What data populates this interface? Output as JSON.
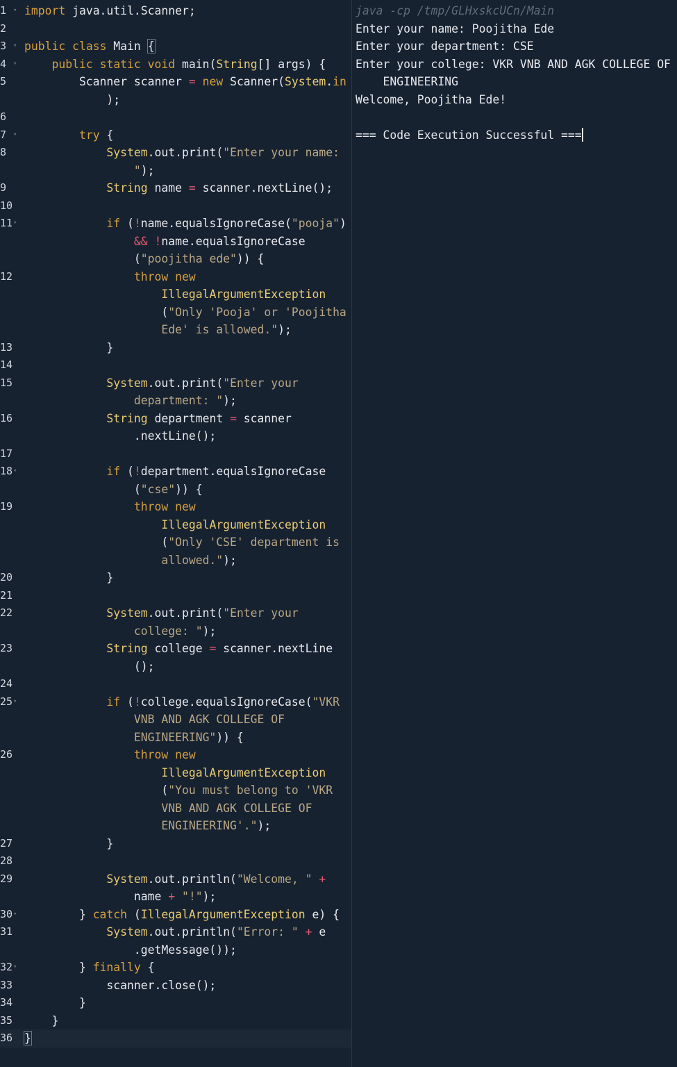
{
  "editor": {
    "lines": [
      {
        "num": "1",
        "fold": true,
        "tokens": [
          [
            "kw",
            "import"
          ],
          [
            "pl",
            " java.util.Scanner;"
          ]
        ]
      },
      {
        "num": "2",
        "fold": false,
        "tokens": []
      },
      {
        "num": "3",
        "fold": true,
        "tokens": [
          [
            "kw",
            "public"
          ],
          [
            "pl",
            " "
          ],
          [
            "kw",
            "class"
          ],
          [
            "pl",
            " Main "
          ],
          [
            "bracket",
            "{"
          ]
        ]
      },
      {
        "num": "4",
        "fold": true,
        "tokens": [
          [
            "pl",
            "    "
          ],
          [
            "kw",
            "public"
          ],
          [
            "pl",
            " "
          ],
          [
            "kw",
            "static"
          ],
          [
            "pl",
            " "
          ],
          [
            "kw",
            "void"
          ],
          [
            "pl",
            " main("
          ],
          [
            "cls",
            "String"
          ],
          [
            "pl",
            "[] args) {"
          ]
        ]
      },
      {
        "num": "5",
        "fold": false,
        "tokens": [
          [
            "pl",
            "        Scanner scanner "
          ],
          [
            "op",
            "="
          ],
          [
            "pl",
            " "
          ],
          [
            "kw",
            "new"
          ],
          [
            "pl",
            " Scanner("
          ],
          [
            "cls",
            "System"
          ],
          [
            "pl",
            "."
          ],
          [
            "kw",
            "in"
          ]
        ]
      },
      {
        "num": "",
        "fold": false,
        "tokens": [
          [
            "pl",
            "            );"
          ]
        ]
      },
      {
        "num": "6",
        "fold": false,
        "tokens": []
      },
      {
        "num": "7",
        "fold": true,
        "tokens": [
          [
            "pl",
            "        "
          ],
          [
            "kw",
            "try"
          ],
          [
            "pl",
            " {"
          ]
        ]
      },
      {
        "num": "8",
        "fold": false,
        "tokens": [
          [
            "pl",
            "            "
          ],
          [
            "cls",
            "System"
          ],
          [
            "pl",
            ".out.print("
          ],
          [
            "str",
            "\"Enter your name:"
          ]
        ]
      },
      {
        "num": "",
        "fold": false,
        "tokens": [
          [
            "str",
            "                \""
          ],
          [
            "pl",
            ");"
          ]
        ]
      },
      {
        "num": "9",
        "fold": false,
        "tokens": [
          [
            "pl",
            "            "
          ],
          [
            "cls",
            "String"
          ],
          [
            "pl",
            " name "
          ],
          [
            "op",
            "="
          ],
          [
            "pl",
            " scanner.nextLine();"
          ]
        ]
      },
      {
        "num": "10",
        "fold": false,
        "tokens": []
      },
      {
        "num": "11",
        "fold": true,
        "tokens": [
          [
            "pl",
            "            "
          ],
          [
            "kw",
            "if"
          ],
          [
            "pl",
            " ("
          ],
          [
            "op",
            "!"
          ],
          [
            "pl",
            "name.equalsIgnoreCase("
          ],
          [
            "str",
            "\"pooja\""
          ],
          [
            "pl",
            ")"
          ]
        ]
      },
      {
        "num": "",
        "fold": false,
        "tokens": [
          [
            "pl",
            "                "
          ],
          [
            "op",
            "&&"
          ],
          [
            "pl",
            " "
          ],
          [
            "op",
            "!"
          ],
          [
            "pl",
            "name.equalsIgnoreCase"
          ]
        ]
      },
      {
        "num": "",
        "fold": false,
        "tokens": [
          [
            "pl",
            "                ("
          ],
          [
            "str",
            "\"poojitha ede\""
          ],
          [
            "pl",
            ")) {"
          ]
        ]
      },
      {
        "num": "12",
        "fold": false,
        "tokens": [
          [
            "pl",
            "                "
          ],
          [
            "kw",
            "throw"
          ],
          [
            "pl",
            " "
          ],
          [
            "kw",
            "new"
          ]
        ]
      },
      {
        "num": "",
        "fold": false,
        "tokens": [
          [
            "pl",
            "                    "
          ],
          [
            "ex",
            "IllegalArgumentException"
          ]
        ]
      },
      {
        "num": "",
        "fold": false,
        "tokens": [
          [
            "pl",
            "                    ("
          ],
          [
            "str",
            "\"Only 'Pooja' or 'Poojitha"
          ]
        ]
      },
      {
        "num": "",
        "fold": false,
        "tokens": [
          [
            "str",
            "                    Ede' is allowed.\""
          ],
          [
            "pl",
            ");"
          ]
        ]
      },
      {
        "num": "13",
        "fold": false,
        "tokens": [
          [
            "pl",
            "            }"
          ]
        ]
      },
      {
        "num": "14",
        "fold": false,
        "tokens": []
      },
      {
        "num": "15",
        "fold": false,
        "tokens": [
          [
            "pl",
            "            "
          ],
          [
            "cls",
            "System"
          ],
          [
            "pl",
            ".out.print("
          ],
          [
            "str",
            "\"Enter your"
          ]
        ]
      },
      {
        "num": "",
        "fold": false,
        "tokens": [
          [
            "str",
            "                department: \""
          ],
          [
            "pl",
            ");"
          ]
        ]
      },
      {
        "num": "16",
        "fold": false,
        "tokens": [
          [
            "pl",
            "            "
          ],
          [
            "cls",
            "String"
          ],
          [
            "pl",
            " department "
          ],
          [
            "op",
            "="
          ],
          [
            "pl",
            " scanner"
          ]
        ]
      },
      {
        "num": "",
        "fold": false,
        "tokens": [
          [
            "pl",
            "                .nextLine();"
          ]
        ]
      },
      {
        "num": "17",
        "fold": false,
        "tokens": []
      },
      {
        "num": "18",
        "fold": true,
        "tokens": [
          [
            "pl",
            "            "
          ],
          [
            "kw",
            "if"
          ],
          [
            "pl",
            " ("
          ],
          [
            "op",
            "!"
          ],
          [
            "pl",
            "department.equalsIgnoreCase"
          ]
        ]
      },
      {
        "num": "",
        "fold": false,
        "tokens": [
          [
            "pl",
            "                ("
          ],
          [
            "str",
            "\"cse\""
          ],
          [
            "pl",
            ")) {"
          ]
        ]
      },
      {
        "num": "19",
        "fold": false,
        "tokens": [
          [
            "pl",
            "                "
          ],
          [
            "kw",
            "throw"
          ],
          [
            "pl",
            " "
          ],
          [
            "kw",
            "new"
          ]
        ]
      },
      {
        "num": "",
        "fold": false,
        "tokens": [
          [
            "pl",
            "                    "
          ],
          [
            "ex",
            "IllegalArgumentException"
          ]
        ]
      },
      {
        "num": "",
        "fold": false,
        "tokens": [
          [
            "pl",
            "                    ("
          ],
          [
            "str",
            "\"Only 'CSE' department is"
          ]
        ]
      },
      {
        "num": "",
        "fold": false,
        "tokens": [
          [
            "str",
            "                    allowed.\""
          ],
          [
            "pl",
            ");"
          ]
        ]
      },
      {
        "num": "20",
        "fold": false,
        "tokens": [
          [
            "pl",
            "            }"
          ]
        ]
      },
      {
        "num": "21",
        "fold": false,
        "tokens": []
      },
      {
        "num": "22",
        "fold": false,
        "tokens": [
          [
            "pl",
            "            "
          ],
          [
            "cls",
            "System"
          ],
          [
            "pl",
            ".out.print("
          ],
          [
            "str",
            "\"Enter your"
          ]
        ]
      },
      {
        "num": "",
        "fold": false,
        "tokens": [
          [
            "str",
            "                college: \""
          ],
          [
            "pl",
            ");"
          ]
        ]
      },
      {
        "num": "23",
        "fold": false,
        "tokens": [
          [
            "pl",
            "            "
          ],
          [
            "cls",
            "String"
          ],
          [
            "pl",
            " college "
          ],
          [
            "op",
            "="
          ],
          [
            "pl",
            " scanner.nextLine"
          ]
        ]
      },
      {
        "num": "",
        "fold": false,
        "tokens": [
          [
            "pl",
            "                ();"
          ]
        ]
      },
      {
        "num": "24",
        "fold": false,
        "tokens": []
      },
      {
        "num": "25",
        "fold": true,
        "tokens": [
          [
            "pl",
            "            "
          ],
          [
            "kw",
            "if"
          ],
          [
            "pl",
            " ("
          ],
          [
            "op",
            "!"
          ],
          [
            "pl",
            "college.equalsIgnoreCase("
          ],
          [
            "str",
            "\"VKR"
          ]
        ]
      },
      {
        "num": "",
        "fold": false,
        "tokens": [
          [
            "str",
            "                VNB AND AGK COLLEGE OF"
          ]
        ]
      },
      {
        "num": "",
        "fold": false,
        "tokens": [
          [
            "str",
            "                ENGINEERING\""
          ],
          [
            "pl",
            ")) {"
          ]
        ]
      },
      {
        "num": "26",
        "fold": false,
        "tokens": [
          [
            "pl",
            "                "
          ],
          [
            "kw",
            "throw"
          ],
          [
            "pl",
            " "
          ],
          [
            "kw",
            "new"
          ]
        ]
      },
      {
        "num": "",
        "fold": false,
        "tokens": [
          [
            "pl",
            "                    "
          ],
          [
            "ex",
            "IllegalArgumentException"
          ]
        ]
      },
      {
        "num": "",
        "fold": false,
        "tokens": [
          [
            "pl",
            "                    ("
          ],
          [
            "str",
            "\"You must belong to 'VKR"
          ]
        ]
      },
      {
        "num": "",
        "fold": false,
        "tokens": [
          [
            "str",
            "                    VNB AND AGK COLLEGE OF"
          ]
        ]
      },
      {
        "num": "",
        "fold": false,
        "tokens": [
          [
            "str",
            "                    ENGINEERING'.\""
          ],
          [
            "pl",
            ");"
          ]
        ]
      },
      {
        "num": "27",
        "fold": false,
        "tokens": [
          [
            "pl",
            "            }"
          ]
        ]
      },
      {
        "num": "28",
        "fold": false,
        "tokens": []
      },
      {
        "num": "29",
        "fold": false,
        "tokens": [
          [
            "pl",
            "            "
          ],
          [
            "cls",
            "System"
          ],
          [
            "pl",
            ".out.println("
          ],
          [
            "str",
            "\"Welcome, \""
          ],
          [
            "pl",
            " "
          ],
          [
            "op",
            "+"
          ]
        ]
      },
      {
        "num": "",
        "fold": false,
        "tokens": [
          [
            "pl",
            "                name "
          ],
          [
            "op",
            "+"
          ],
          [
            "pl",
            " "
          ],
          [
            "str",
            "\"!\""
          ],
          [
            "pl",
            ");"
          ]
        ]
      },
      {
        "num": "30",
        "fold": true,
        "tokens": [
          [
            "pl",
            "        } "
          ],
          [
            "kw",
            "catch"
          ],
          [
            "pl",
            " ("
          ],
          [
            "ex",
            "IllegalArgumentException"
          ],
          [
            "pl",
            " e) {"
          ]
        ]
      },
      {
        "num": "31",
        "fold": false,
        "tokens": [
          [
            "pl",
            "            "
          ],
          [
            "cls",
            "System"
          ],
          [
            "pl",
            ".out.println("
          ],
          [
            "str",
            "\"Error: \""
          ],
          [
            "pl",
            " "
          ],
          [
            "op",
            "+"
          ],
          [
            "pl",
            " e"
          ]
        ]
      },
      {
        "num": "",
        "fold": false,
        "tokens": [
          [
            "pl",
            "                .getMessage());"
          ]
        ]
      },
      {
        "num": "32",
        "fold": true,
        "tokens": [
          [
            "pl",
            "        } "
          ],
          [
            "kw",
            "finally"
          ],
          [
            "pl",
            " {"
          ]
        ]
      },
      {
        "num": "33",
        "fold": false,
        "tokens": [
          [
            "pl",
            "            scanner.close();"
          ]
        ]
      },
      {
        "num": "34",
        "fold": false,
        "tokens": [
          [
            "pl",
            "        }"
          ]
        ]
      },
      {
        "num": "35",
        "fold": false,
        "tokens": [
          [
            "pl",
            "    }"
          ]
        ]
      },
      {
        "num": "36",
        "fold": false,
        "tokens": [
          [
            "bracket",
            "}"
          ]
        ]
      }
    ]
  },
  "output": {
    "command": "java -cp /tmp/GLHxskcUCn/Main",
    "lines": [
      "Enter your name: Poojitha Ede",
      "Enter your department: CSE",
      "Enter your college: VKR VNB AND AGK COLLEGE OF",
      "    ENGINEERING",
      "Welcome, Poojitha Ede!",
      "",
      "=== Code Execution Successful ==="
    ]
  }
}
